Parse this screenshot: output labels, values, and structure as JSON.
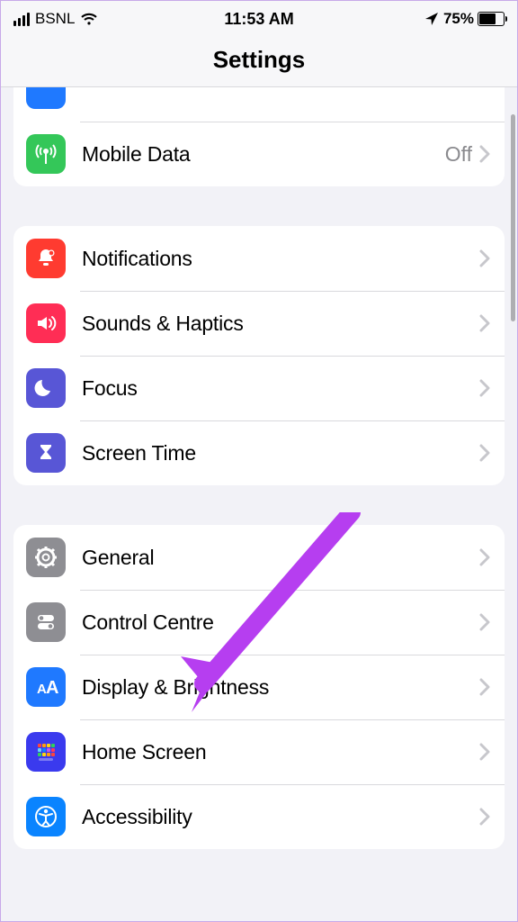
{
  "status_bar": {
    "carrier": "BSNL",
    "time": "11:53 AM",
    "battery_text": "75%",
    "battery_level": 75
  },
  "header": {
    "title": "Settings"
  },
  "groups": [
    {
      "id": "connectivity",
      "partial_top": true,
      "rows": [
        {
          "id": "partial",
          "partial": true,
          "icon_bg": "bg-blue",
          "icon": "",
          "label": "",
          "value": "",
          "chevron": false
        },
        {
          "id": "mobile-data",
          "icon_bg": "bg-green",
          "icon": "antenna",
          "label": "Mobile Data",
          "value": "Off",
          "chevron": true
        }
      ]
    },
    {
      "id": "sounds-focus",
      "rows": [
        {
          "id": "notifications",
          "icon_bg": "bg-red",
          "icon": "bell",
          "label": "Notifications",
          "value": "",
          "chevron": true
        },
        {
          "id": "sounds-haptics",
          "icon_bg": "bg-pink",
          "icon": "speaker",
          "label": "Sounds & Haptics",
          "value": "",
          "chevron": true
        },
        {
          "id": "focus",
          "icon_bg": "bg-indigo",
          "icon": "moon",
          "label": "Focus",
          "value": "",
          "chevron": true
        },
        {
          "id": "screen-time",
          "icon_bg": "bg-indigo",
          "icon": "hourglass",
          "label": "Screen Time",
          "value": "",
          "chevron": true
        }
      ]
    },
    {
      "id": "general-display",
      "rows": [
        {
          "id": "general",
          "icon_bg": "bg-gray",
          "icon": "gear",
          "label": "General",
          "value": "",
          "chevron": true
        },
        {
          "id": "control-centre",
          "icon_bg": "bg-gray",
          "icon": "toggles",
          "label": "Control Centre",
          "value": "",
          "chevron": true
        },
        {
          "id": "display-brightness",
          "icon_bg": "bg-blue",
          "icon": "textsize",
          "label": "Display & Brightness",
          "value": "",
          "chevron": true
        },
        {
          "id": "home-screen",
          "icon_bg": "bg-appgrid",
          "icon": "appgrid",
          "label": "Home Screen",
          "value": "",
          "chevron": true
        },
        {
          "id": "accessibility",
          "icon_bg": "bg-bluelight",
          "icon": "accessibility",
          "label": "Accessibility",
          "value": "",
          "chevron": true
        }
      ]
    }
  ],
  "annotation": {
    "arrow_color": "#b63ef0"
  }
}
